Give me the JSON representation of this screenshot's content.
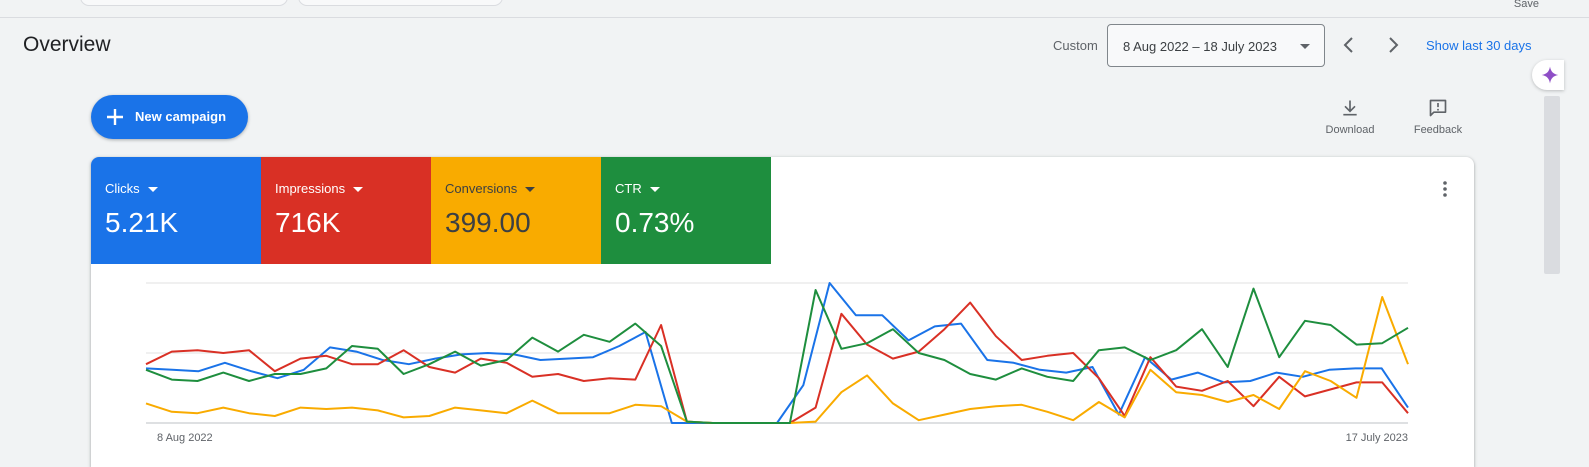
{
  "header": {
    "save_label": "Save",
    "title": "Overview",
    "custom_label": "Custom",
    "date_range": "8 Aug 2022 – 18 July 2023",
    "show_last_label": "Show last 30 days"
  },
  "actions": {
    "new_campaign_label": "New campaign",
    "download_label": "Download",
    "feedback_label": "Feedback"
  },
  "metrics": [
    {
      "name": "Clicks",
      "value": "5.21K",
      "color": "#1a73e8",
      "text_color": "#ffffff"
    },
    {
      "name": "Impressions",
      "value": "716K",
      "color": "#d93025",
      "text_color": "#ffffff"
    },
    {
      "name": "Conversions",
      "value": "399.00",
      "color": "#f9ab00",
      "text_color": "#3c4043"
    },
    {
      "name": "CTR",
      "value": "0.73%",
      "color": "#1e8e3e",
      "text_color": "#ffffff"
    }
  ],
  "chart_data": {
    "type": "line",
    "x_start_label": "8 Aug 2022",
    "x_end_label": "17 July 2023",
    "grid": true,
    "y_range": [
      0,
      1
    ],
    "series": [
      {
        "color": "#1a73e8",
        "values": [
          0.39,
          0.38,
          0.37,
          0.43,
          0.37,
          0.32,
          0.38,
          0.54,
          0.51,
          0.45,
          0.42,
          0.46,
          0.49,
          0.5,
          0.49,
          0.45,
          0.46,
          0.47,
          0.55,
          0.65,
          0.0,
          0.0,
          0.0,
          0.0,
          0.0,
          0.27,
          1.0,
          0.77,
          0.77,
          0.59,
          0.69,
          0.71,
          0.45,
          0.43,
          0.38,
          0.36,
          0.4,
          0.06,
          0.47,
          0.31,
          0.36,
          0.29,
          0.3,
          0.36,
          0.33,
          0.38,
          0.39,
          0.39,
          0.11
        ]
      },
      {
        "color": "#d93025",
        "values": [
          0.42,
          0.51,
          0.52,
          0.5,
          0.52,
          0.37,
          0.46,
          0.48,
          0.42,
          0.42,
          0.52,
          0.4,
          0.36,
          0.46,
          0.43,
          0.33,
          0.35,
          0.3,
          0.32,
          0.31,
          0.7,
          0.01,
          0.0,
          0.0,
          0.0,
          0.0,
          0.11,
          0.78,
          0.56,
          0.46,
          0.51,
          0.67,
          0.86,
          0.62,
          0.45,
          0.48,
          0.5,
          0.32,
          0.05,
          0.47,
          0.26,
          0.23,
          0.3,
          0.12,
          0.33,
          0.19,
          0.24,
          0.29,
          0.29,
          0.07
        ]
      },
      {
        "color": "#f9ab00",
        "values": [
          0.14,
          0.08,
          0.07,
          0.11,
          0.07,
          0.05,
          0.11,
          0.1,
          0.11,
          0.09,
          0.04,
          0.05,
          0.11,
          0.09,
          0.07,
          0.16,
          0.07,
          0.07,
          0.07,
          0.13,
          0.12,
          0.01,
          0.0,
          0.0,
          0.0,
          0.0,
          0.01,
          0.22,
          0.34,
          0.14,
          0.02,
          0.06,
          0.1,
          0.12,
          0.13,
          0.08,
          0.02,
          0.15,
          0.04,
          0.38,
          0.22,
          0.2,
          0.15,
          0.2,
          0.1,
          0.37,
          0.3,
          0.18,
          0.9,
          0.42
        ]
      },
      {
        "color": "#1e8e3e",
        "values": [
          0.38,
          0.31,
          0.3,
          0.36,
          0.3,
          0.35,
          0.35,
          0.39,
          0.55,
          0.53,
          0.35,
          0.42,
          0.51,
          0.41,
          0.45,
          0.61,
          0.51,
          0.63,
          0.58,
          0.71,
          0.55,
          0.01,
          0.0,
          0.0,
          0.0,
          0.0,
          0.95,
          0.53,
          0.57,
          0.67,
          0.5,
          0.45,
          0.35,
          0.31,
          0.39,
          0.33,
          0.3,
          0.52,
          0.54,
          0.45,
          0.52,
          0.67,
          0.4,
          0.96,
          0.47,
          0.73,
          0.7,
          0.56,
          0.57,
          0.68
        ]
      }
    ]
  }
}
